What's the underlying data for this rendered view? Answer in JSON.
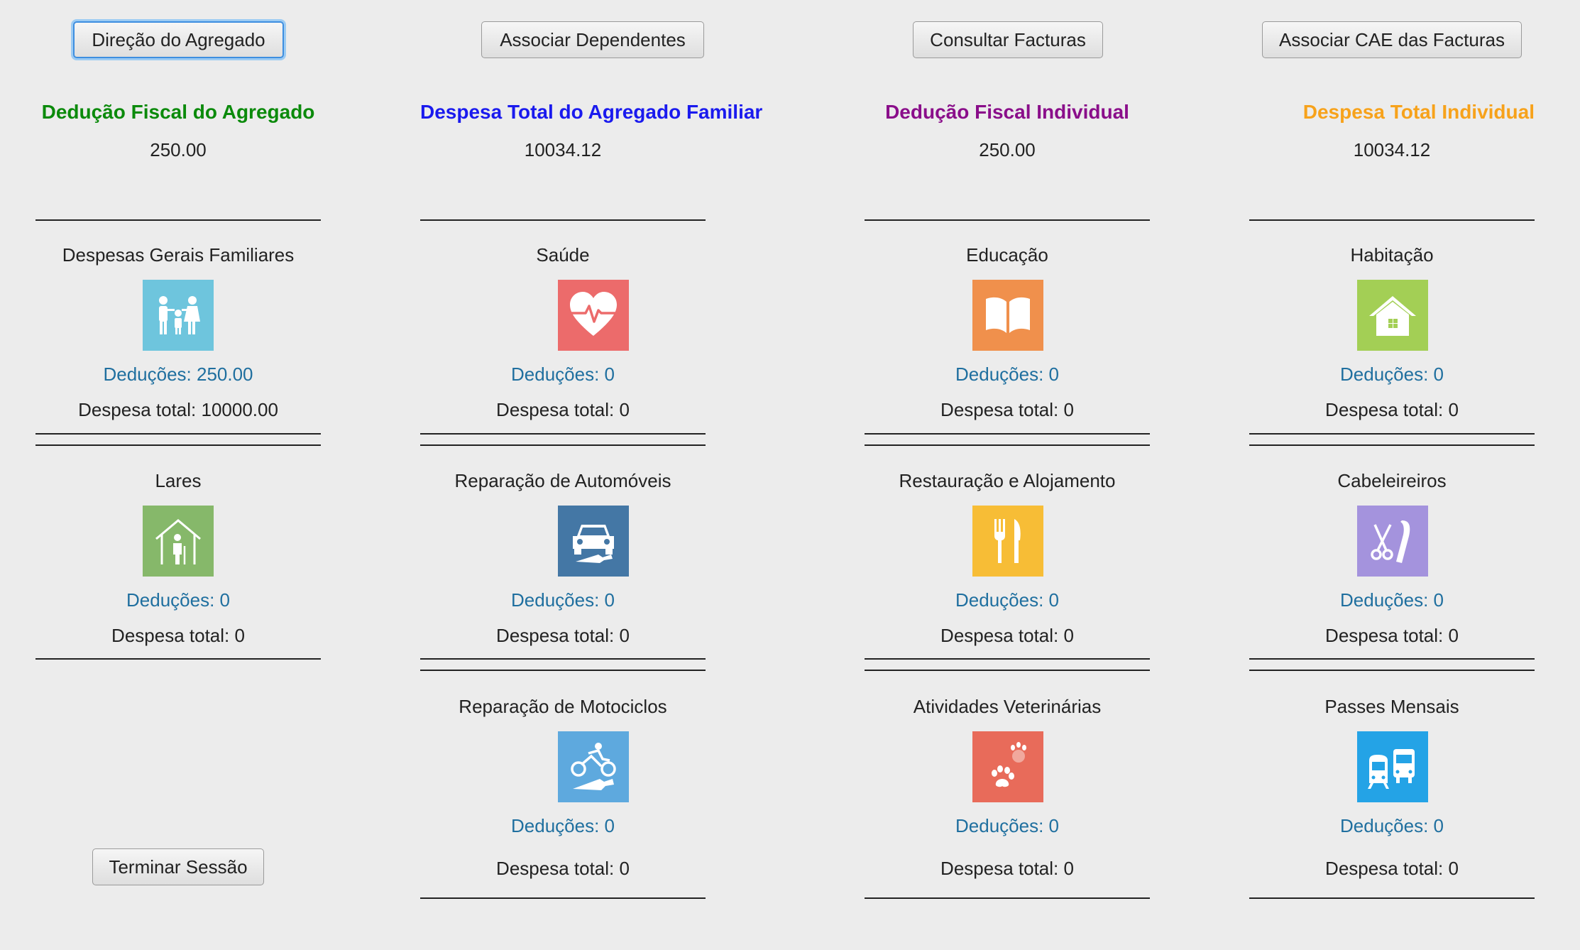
{
  "toolbar": {
    "direcao_label": "Direção do Agregado",
    "dependentes_label": "Associar Dependentes",
    "facturas_label": "Consultar Facturas",
    "cae_label": "Associar CAE das Facturas",
    "logout_label": "Terminar Sessão"
  },
  "summary": {
    "agregado_deducao": {
      "title": "Dedução Fiscal do Agregado",
      "value": "250.00",
      "color": "#0b8a0b"
    },
    "agregado_despesa": {
      "title": "Despesa Total do Agregado Familiar",
      "value": "10034.12",
      "color": "#1a1aee"
    },
    "individual_deducao": {
      "title": "Dedução Fiscal Individual",
      "value": "250.00",
      "color": "#8a0e8a"
    },
    "individual_despesa": {
      "title": "Despesa Total Individual",
      "value": "10034.12",
      "color": "#f7a21b"
    }
  },
  "categories": {
    "familiares": {
      "label": "Despesas Gerais Familiares",
      "deducoes": "Deduções: 250.00",
      "despesa": "Despesa total: 10000.00",
      "icon": "family-icon",
      "color": "#6ec5dd"
    },
    "lares": {
      "label": "Lares",
      "deducoes": "Deduções: 0",
      "despesa": "Despesa total: 0",
      "icon": "elderly-home-icon",
      "color": "#86b86a"
    },
    "saude": {
      "label": "Saúde",
      "deducoes": "Deduções: 0",
      "despesa": "Despesa total: 0",
      "icon": "heart-pulse-icon",
      "color": "#ec6b6b"
    },
    "automoveis": {
      "label": "Reparação de Automóveis",
      "deducoes": "Deduções: 0",
      "despesa": "Despesa total: 0",
      "icon": "car-repair-icon",
      "color": "#4477a5"
    },
    "motociclos": {
      "label": "Reparação de Motociclos",
      "deducoes": "Deduções: 0",
      "despesa": "Despesa total: 0",
      "icon": "motorcycle-repair-icon",
      "color": "#5ea9de"
    },
    "educacao": {
      "label": "Educação",
      "deducoes": "Deduções: 0",
      "despesa": "Despesa total: 0",
      "icon": "book-icon",
      "color": "#f0904c"
    },
    "restauracao": {
      "label": "Restauração e Alojamento",
      "deducoes": "Deduções: 0",
      "despesa": "Despesa total: 0",
      "icon": "fork-knife-icon",
      "color": "#f7bd36"
    },
    "veterinarias": {
      "label": "Atividades Veterinárias",
      "deducoes": "Deduções: 0",
      "despesa": "Despesa total: 0",
      "icon": "paw-icon",
      "color": "#e86b5a"
    },
    "habitacao": {
      "label": "Habitação",
      "deducoes": "Deduções: 0",
      "despesa": "Despesa total: 0",
      "icon": "house-icon",
      "color": "#a3cf55"
    },
    "cabeleireiros": {
      "label": "Cabeleireiros",
      "deducoes": "Deduções: 0",
      "despesa": "Despesa total: 0",
      "icon": "scissors-comb-icon",
      "color": "#a493dd"
    },
    "passes": {
      "label": "Passes Mensais",
      "deducoes": "Deduções: 0",
      "despesa": "Despesa total: 0",
      "icon": "bus-train-icon",
      "color": "#24a3e6"
    }
  }
}
